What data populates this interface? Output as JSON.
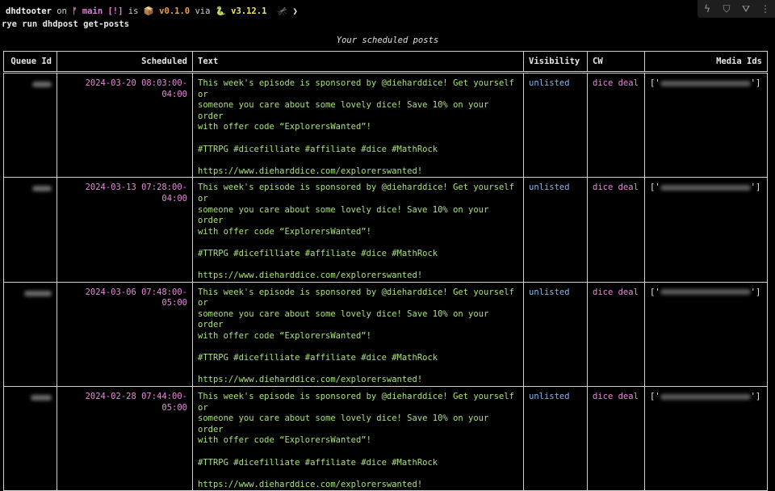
{
  "terminal": {
    "project": "dhdtooter",
    "on": "on",
    "branch_icon": "",
    "branch": "main",
    "status_flag": "[!]",
    "is": "is",
    "package_icon": "📦",
    "version": "v0.1.0",
    "via": "via",
    "python_icon": "🐍",
    "python_version": "v3.12.1",
    "misc_icon": "🦟",
    "chevron": "❯",
    "command": "rye run dhdpost get-posts"
  },
  "toolbar": {
    "icons": [
      "bolt-icon",
      "bookmark-icon",
      "filter-icon",
      "more-icon"
    ],
    "glyphs": [
      "ϟ",
      "⛉",
      "⛛",
      "⋮"
    ]
  },
  "caption": "Your scheduled posts",
  "table": {
    "headers": [
      "Queue Id",
      "Scheduled",
      "Text",
      "Visibility",
      "CW",
      "Media Ids"
    ],
    "rows": [
      {
        "scheduled": "2024-03-20 08:03:00-04:00",
        "text": "This week's episode is sponsored by @dieharddice! Get yourself or\nsomeone you care about some lovely dice! Save 10% on your order\nwith offer code “ExplorersWanted”!\n\n#TTRPG #dicefilliate #affiliate #dice #MathRock\n\nhttps://www.dieharddice.com/explorerswanted!",
        "visibility": "unlisted",
        "cw": "dice deal",
        "media_open": "['",
        "media_close": "']"
      },
      {
        "scheduled": "2024-03-13 07:28:00-04:00",
        "text": "This week's episode is sponsored by @dieharddice! Get yourself or\nsomeone you care about some lovely dice! Save 10% on your order\nwith offer code “ExplorersWanted”!\n\n#TTRPG #dicefilliate #affiliate #dice #MathRock\n\nhttps://www.dieharddice.com/explorerswanted!",
        "visibility": "unlisted",
        "cw": "dice deal",
        "media_open": "['",
        "media_close": "']"
      },
      {
        "scheduled": "2024-03-06 07:48:00-05:00",
        "text": "This week's episode is sponsored by @dieharddice! Get yourself or\nsomeone you care about some lovely dice! Save 10% on your order\nwith offer code “ExplorersWanted”!\n\n#TTRPG #dicefilliate #affiliate #dice #MathRock\n\nhttps://www.dieharddice.com/explorerswanted!",
        "visibility": "unlisted",
        "cw": "dice deal",
        "media_open": "['",
        "media_close": "']"
      },
      {
        "scheduled": "2024-02-28 07:44:00-05:00",
        "text": "This week's episode is sponsored by @dieharddice! Get yourself or\nsomeone you care about some lovely dice! Save 10% on your order\nwith offer code “ExplorersWanted”!\n\n#TTRPG #dicefilliate #affiliate #dice #MathRock\n\nhttps://www.dieharddice.com/explorerswanted!",
        "visibility": "unlisted",
        "cw": "dice deal",
        "media_open": "['",
        "media_close": "']"
      }
    ]
  }
}
